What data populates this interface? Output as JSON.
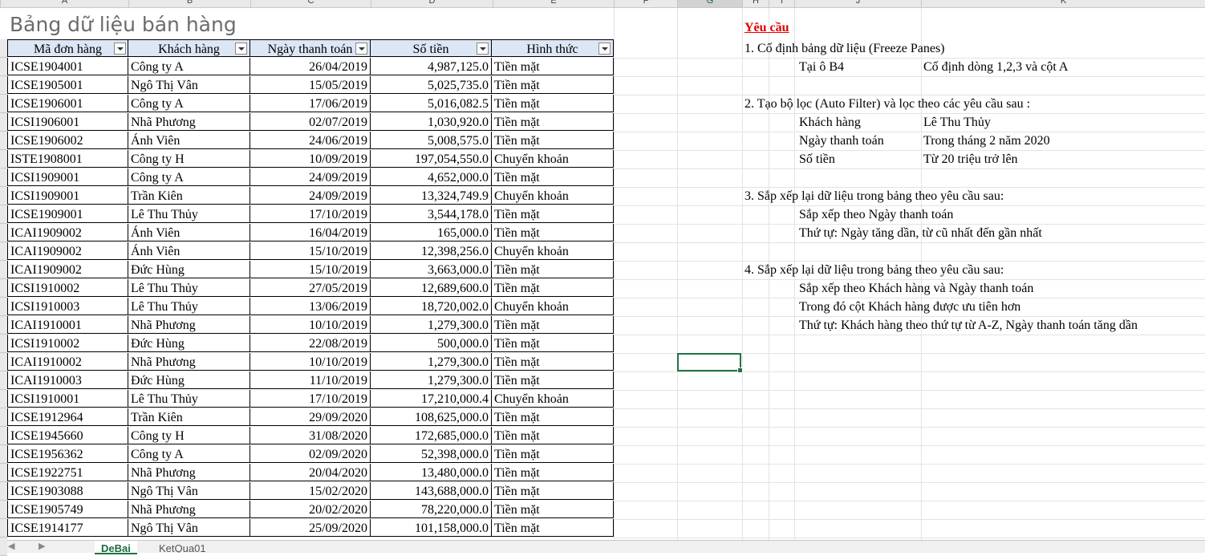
{
  "column_headers": [
    "A",
    "B",
    "C",
    "D",
    "E",
    "F",
    "G",
    "H",
    "I",
    "J",
    "K"
  ],
  "selected_column": "G",
  "sheet_title": "Bảng dữ liệu bán hàng",
  "table": {
    "headers": [
      "Mã đơn hàng",
      "Khách hàng",
      "Ngày thanh toán",
      "Số tiền",
      "Hình thức"
    ],
    "rows": [
      [
        "ICSE1904001",
        "Công ty A",
        "26/04/2019",
        "4,987,125.0",
        "Tiền mặt"
      ],
      [
        "ICSE1905001",
        "Ngô Thị Vân",
        "15/05/2019",
        "5,025,735.0",
        "Tiền mặt"
      ],
      [
        "ICSE1906001",
        "Công ty A",
        "17/06/2019",
        "5,016,082.5",
        "Tiền mặt"
      ],
      [
        "ICSI1906001",
        "Nhã Phương",
        "02/07/2019",
        "1,030,920.0",
        "Tiền mặt"
      ],
      [
        "ICSE1906002",
        "Ánh Viên",
        "24/06/2019",
        "5,008,575.0",
        "Tiền mặt"
      ],
      [
        "ISTE1908001",
        "Công ty H",
        "10/09/2019",
        "197,054,550.0",
        "Chuyển khoản"
      ],
      [
        "ICSI1909001",
        "Công ty A",
        "24/09/2019",
        "4,652,000.0",
        "Tiền mặt"
      ],
      [
        "ICSI1909001",
        "Trần Kiên",
        "24/09/2019",
        "13,324,749.9",
        "Chuyển khoản"
      ],
      [
        "ICSE1909001",
        "Lê Thu Thủy",
        "17/10/2019",
        "3,544,178.0",
        "Tiền mặt"
      ],
      [
        "ICAI1909002",
        "Ánh Viên",
        "16/04/2019",
        "165,000.0",
        "Tiền mặt"
      ],
      [
        "ICAI1909002",
        "Ánh Viên",
        "15/10/2019",
        "12,398,256.0",
        "Chuyển khoản"
      ],
      [
        "ICAI1909002",
        "Đức Hùng",
        "15/10/2019",
        "3,663,000.0",
        "Tiền mặt"
      ],
      [
        "ICSI1910002",
        "Lê Thu Thủy",
        "27/05/2019",
        "12,689,600.0",
        "Tiền mặt"
      ],
      [
        "ICSI1910003",
        "Lê Thu Thủy",
        "13/06/2019",
        "18,720,002.0",
        "Chuyển khoản"
      ],
      [
        "ICAI1910001",
        "Nhã Phương",
        "10/10/2019",
        "1,279,300.0",
        "Tiền mặt"
      ],
      [
        "ICSI1910002",
        "Đức Hùng",
        "22/08/2019",
        "500,000.0",
        "Tiền mặt"
      ],
      [
        "ICAI1910002",
        "Nhã Phương",
        "10/10/2019",
        "1,279,300.0",
        "Tiền mặt"
      ],
      [
        "ICAI1910003",
        "Đức Hùng",
        "11/10/2019",
        "1,279,300.0",
        "Tiền mặt"
      ],
      [
        "ICSI1910001",
        "Lê Thu Thủy",
        "17/10/2019",
        "17,210,000.4",
        "Chuyển khoản"
      ],
      [
        "ICSE1912964",
        "Trần Kiên",
        "29/09/2020",
        "108,625,000.0",
        "Tiền mặt"
      ],
      [
        "ICSE1945660",
        "Công ty H",
        "31/08/2020",
        "172,685,000.0",
        "Tiền mặt"
      ],
      [
        "ICSE1956362",
        "Công ty A",
        "02/09/2020",
        "52,398,000.0",
        "Tiền mặt"
      ],
      [
        "ICSE1922751",
        "Nhã Phương",
        "20/04/2020",
        "13,480,000.0",
        "Tiền mặt"
      ],
      [
        "ICSE1903088",
        "Ngô Thị Vân",
        "15/02/2020",
        "143,688,000.0",
        "Tiền mặt"
      ],
      [
        "ICSE1905749",
        "Nhã Phương",
        "20/02/2020",
        "78,220,000.0",
        "Tiền mặt"
      ],
      [
        "ICSE1914177",
        "Ngô Thị Vân",
        "25/09/2020",
        "101,158,000.0",
        "Tiền mặt"
      ]
    ]
  },
  "requirements": {
    "heading": "Yêu cầu",
    "lines": [
      {
        "t": "1. Cố định bảng dữ liệu (Freeze Panes)"
      },
      {
        "a": "Tại ô B4",
        "b": "Cố định dòng 1,2,3 và cột A"
      },
      {
        "t": "2. Tạo bộ lọc (Auto Filter) và lọc theo các yêu cầu sau :"
      },
      {
        "a": "Khách hàng",
        "b": "Lê Thu Thủy"
      },
      {
        "a": "Ngày thanh toán",
        "b": "Trong tháng 2 năm 2020"
      },
      {
        "a": "Số tiền",
        "b": "Từ 20 triệu trở lên"
      },
      {
        "t": "3. Sắp xếp lại dữ liệu trong bảng theo yêu cầu sau:"
      },
      {
        "a": "Sắp xếp theo Ngày thanh toán"
      },
      {
        "a": "Thứ tự: Ngày tăng dần, từ cũ nhất đến gần nhất"
      },
      {
        "t": "4. Sắp xếp lại dữ liệu trong bảng theo yêu cầu sau:"
      },
      {
        "a": "Sắp xếp theo Khách hàng và Ngày thanh toán"
      },
      {
        "a": "Trong đó cột Khách hàng được ưu tiên hơn"
      },
      {
        "a": "Thứ tự: Khách hàng theo thứ tự từ A-Z, Ngày thanh toán tăng dần"
      }
    ]
  },
  "sheet_tabs": [
    "DeBai",
    "KetQua01"
  ],
  "active_tab": "DeBai"
}
